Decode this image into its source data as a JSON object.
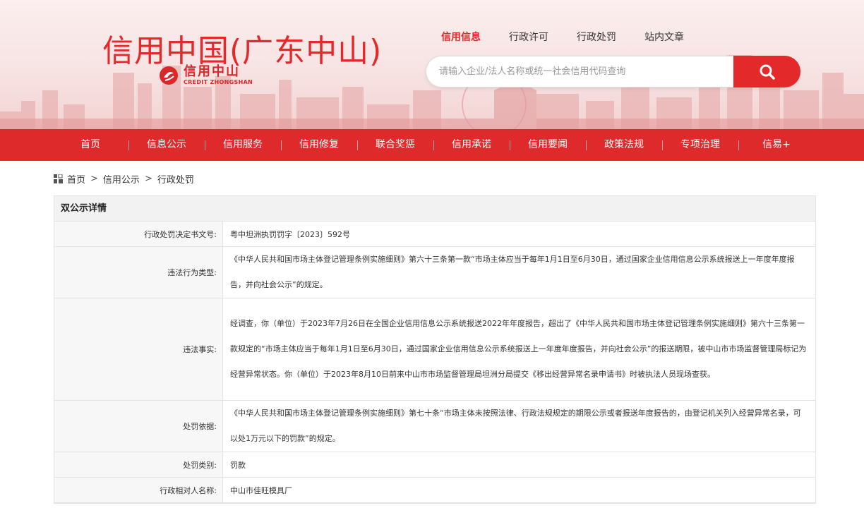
{
  "header": {
    "site_title": "信用中国(广东中山)",
    "logo_cn": "信用中山",
    "logo_en": "CREDIT ZHONGSHAN",
    "topnav": [
      "信用信息",
      "行政许可",
      "行政处罚",
      "站内文章"
    ],
    "search_placeholder": "请输入企业/法人名称或统一社会信用代码查询"
  },
  "mainnav": [
    "首页",
    "信息公示",
    "信用服务",
    "信用修复",
    "联合奖惩",
    "信用承诺",
    "信用要闻",
    "政策法规",
    "专项治理",
    "信易+"
  ],
  "breadcrumb": [
    "首页",
    "信用公示",
    "行政处罚"
  ],
  "detail": {
    "title": "双公示详情",
    "rows": [
      {
        "label": "行政处罚决定书文号:",
        "value": "粤中坦洲执罚罚字〔2023〕592号"
      },
      {
        "label": "违法行为类型:",
        "value": "《中华人民共和国市场主体登记管理条例实施细则》第六十三条第一款“市场主体应当于每年1月1日至6月30日，通过国家企业信用信息公示系统报送上一年度年度报告，并向社会公示”的规定。"
      },
      {
        "label": "违法事实:",
        "value": "经调查，你（单位）于2023年7月26日在全国企业信用信息公示系统报送2022年年度报告，超出了《中华人民共和国市场主体登记管理条例实施细则》第六十三条第一款规定的“市场主体应当于每年1月1日至6月30日，通过国家企业信用信息公示系统报送上一年度年度报告，并向社会公示”的报送期限，被中山市市场监督管理局标记为经营异常状态。你（单位）于2023年8月10日前来中山市市场监督管理局坦洲分局提交《移出经营异常名录申请书》时被执法人员现场查获。"
      },
      {
        "label": "处罚依据:",
        "value": "《中华人民共和国市场主体登记管理条例实施细则》第七十条“市场主体未按照法律、行政法规规定的期限公示或者报送年度报告的，由登记机关列入经营异常名录，可以处1万元以下的罚款”的规定。"
      },
      {
        "label": "处罚类别:",
        "value": "罚款"
      },
      {
        "label": "行政相对人名称:",
        "value": "中山市佳旺模具厂"
      }
    ]
  },
  "colors": {
    "brand_red": "#e4292b",
    "nav_red": "#df2a2c"
  }
}
